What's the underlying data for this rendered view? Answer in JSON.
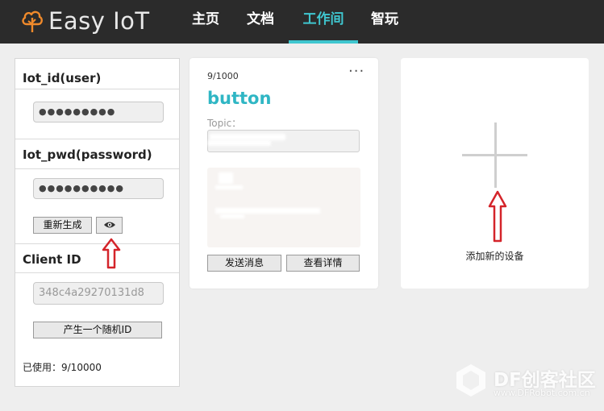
{
  "header": {
    "logo_text": "Easy IoT",
    "nav": [
      {
        "label": "主页",
        "active": false
      },
      {
        "label": "文档",
        "active": false
      },
      {
        "label": "工作间",
        "active": true
      },
      {
        "label": "智玩",
        "active": false
      }
    ]
  },
  "credentials": {
    "user_title": "Iot_id(user)",
    "user_value": "●●●●●●●●●",
    "pwd_title": "Iot_pwd(password)",
    "pwd_value": "●●●●●●●●●●",
    "regenerate_label": "重新生成",
    "eye_icon": "eye-icon",
    "client_title": "Client ID",
    "client_value": "348c4a29270131d8",
    "random_id_label": "产生一个随机ID",
    "used": "已使用：9/10000"
  },
  "device_card": {
    "count": "9/1000",
    "more": "···",
    "name": "button",
    "topic_label": "Topic：",
    "send_label": "发送消息",
    "detail_label": "查看详情"
  },
  "add_device": {
    "label": "添加新的设备",
    "icon": "plus-icon"
  },
  "watermark": {
    "text": "DF创客社区",
    "url": "www.DFRobot.com.cn"
  },
  "colors": {
    "header_bg": "#2b2b2b",
    "accent": "#3fc6cf",
    "device_name": "#2fb6c4",
    "arrow": "#d4242a"
  }
}
